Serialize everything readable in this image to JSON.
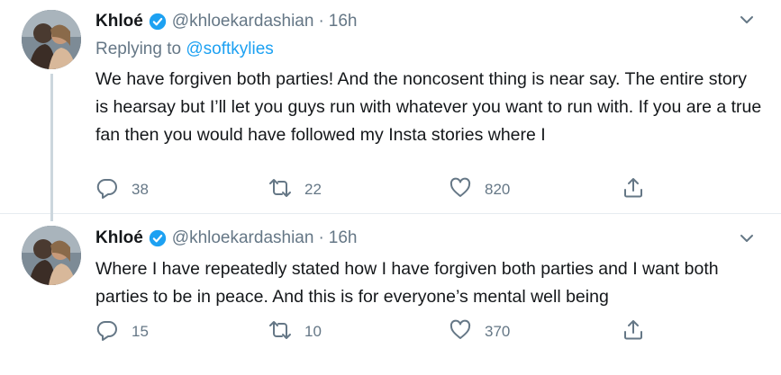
{
  "colors": {
    "text": "#14171a",
    "secondary": "#657786",
    "accent": "#1da1f2",
    "divider": "#e6ecf0",
    "thread_line": "#ccd6dd"
  },
  "tweets": [
    {
      "display_name": "Khloé",
      "verified_icon": "verified-badge-icon",
      "handle": "@khloekardashian",
      "separator": "·",
      "time": "16h",
      "replying_prefix": "Replying to ",
      "replying_mention": "@softkylies",
      "text": "We have forgiven both parties! And the noncosent thing is near say. The entire story is hearsay but I’ll let you guys run with whatever you want to run with. If you are a true fan then you would have followed my Insta stories where I",
      "replies": "38",
      "retweets": "22",
      "likes": "820"
    },
    {
      "display_name": "Khloé",
      "verified_icon": "verified-badge-icon",
      "handle": "@khloekardashian",
      "separator": "·",
      "time": "16h",
      "text": "Where I have repeatedly stated how I have forgiven both parties and I want both parties to be in peace. And this is for everyone’s mental well being",
      "replies": "15",
      "retweets": "10",
      "likes": "370"
    }
  ]
}
